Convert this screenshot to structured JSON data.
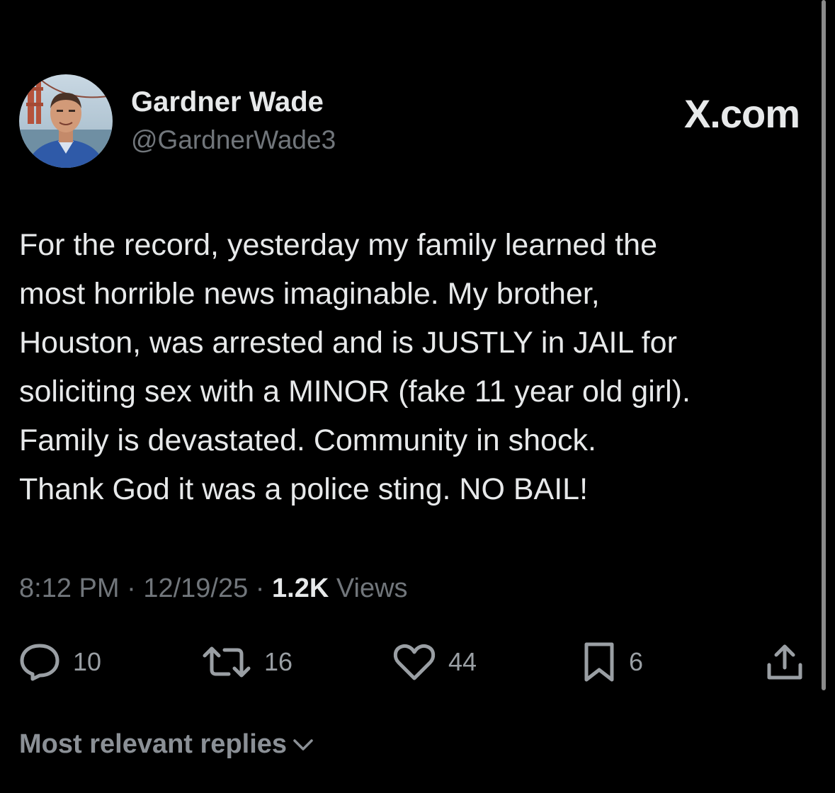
{
  "author": {
    "name": "Gardner Wade",
    "handle": "@GardnerWade3"
  },
  "brand": "X.com",
  "tweet": {
    "text": "For the record, yesterday my family learned the\nmost horrible news imaginable.  My brother,\nHouston, was arrested and is JUSTLY in JAIL for\nsoliciting sex with a MINOR (fake 11 year old girl).\nFamily is devastated.  Community in shock.\nThank God it was a police sting.  NO BAIL!"
  },
  "meta": {
    "time": "8:12 PM",
    "separator": "·",
    "date": "12/19/25",
    "views_count": "1.2K",
    "views_label": "Views"
  },
  "actions": {
    "reply": {
      "icon": "reply-icon",
      "count": "10"
    },
    "repost": {
      "icon": "repost-icon",
      "count": "16"
    },
    "like": {
      "icon": "heart-icon",
      "count": "44"
    },
    "bookmark": {
      "icon": "bookmark-icon",
      "count": "6"
    },
    "share": {
      "icon": "share-icon"
    }
  },
  "replies": {
    "sort_label": "Most relevant replies"
  },
  "colors": {
    "background": "#000000",
    "primary_text": "#e7e9ea",
    "secondary_text": "#71767b"
  }
}
